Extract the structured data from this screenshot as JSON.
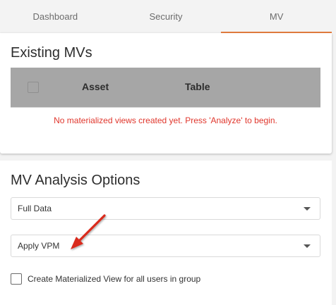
{
  "tabs": [
    {
      "label": "Dashboard",
      "active": false
    },
    {
      "label": "Security",
      "active": false
    },
    {
      "label": "MV",
      "active": true
    }
  ],
  "existing_mvs": {
    "title": "Existing MVs",
    "columns": [
      "Asset",
      "Table"
    ],
    "empty_message": "No materialized views created yet. Press 'Analyze' to begin."
  },
  "analysis_options": {
    "title": "MV Analysis Options",
    "data_select": {
      "value": "Full Data"
    },
    "vpm_select": {
      "value": "Apply VPM"
    },
    "create_for_group": {
      "label": "Create Materialized View for all users in group",
      "checked": false
    }
  },
  "colors": {
    "accent": "#e67e3f",
    "table_header_bg": "#a6a6a6",
    "error_text": "#e0362c",
    "annotation_arrow": "#d92a1e"
  },
  "annotation": {
    "icon": "red-arrow-icon"
  }
}
